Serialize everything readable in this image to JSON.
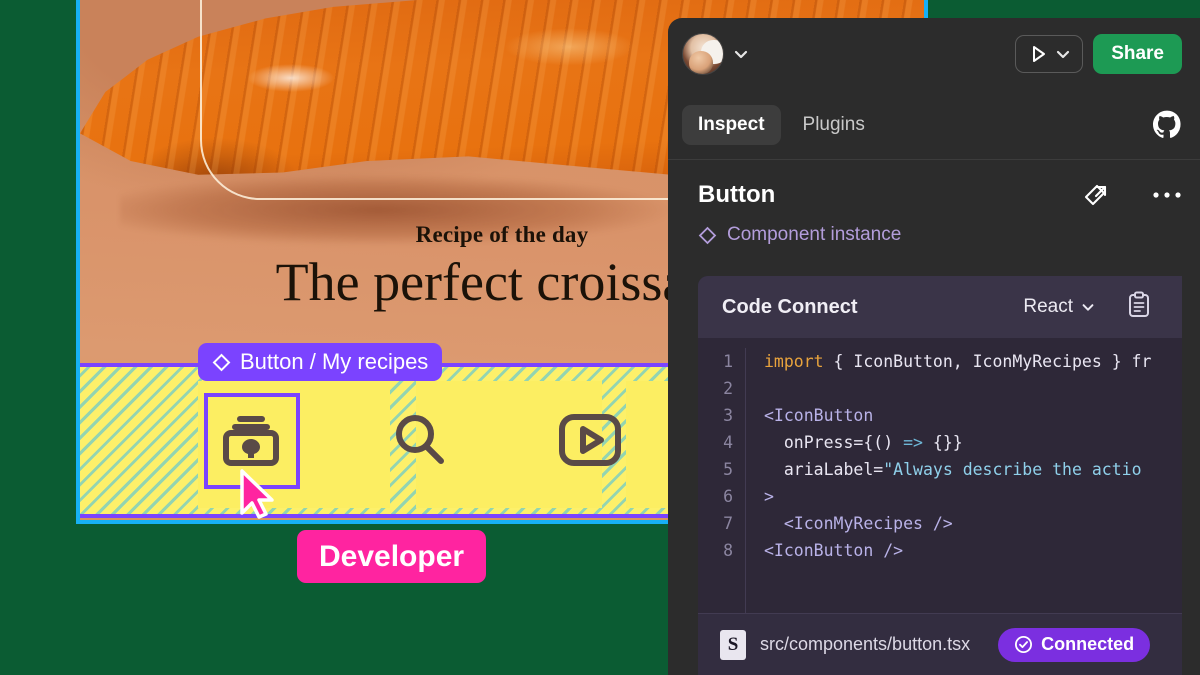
{
  "canvas": {
    "poster": {
      "kicker": "Recipe of the day",
      "headline": "The perfect croissant",
      "bg_color": "#d79465"
    },
    "component_chip": {
      "label": "Button / My recipes",
      "icon": "component-diamond-icon",
      "color": "#7b43ff"
    },
    "developer_badge": {
      "label": "Developer",
      "color": "#ff24a0"
    },
    "toolbar_icons": [
      {
        "name": "my-recipes-icon",
        "selected": true
      },
      {
        "name": "search-icon",
        "selected": false
      },
      {
        "name": "video-play-icon",
        "selected": false
      }
    ],
    "selection_color": "#17b0f5",
    "highlight_color": "#fdf06a"
  },
  "panel": {
    "topbar": {
      "avatar_label": "user-avatar",
      "avatar_caret": "chevron-down-icon",
      "run_label": "play-icon",
      "run_caret": "chevron-down-icon",
      "share_label": "Share",
      "share_color": "#1d9a54"
    },
    "tabs": [
      {
        "label": "Inspect",
        "active": true
      },
      {
        "label": "Plugins",
        "active": false
      }
    ],
    "github_icon": "github-icon",
    "node": {
      "title": "Button",
      "open_icon": "open-external-icon",
      "more_icon": "more-horizontal-icon",
      "instance_label": "Component instance",
      "instance_icon": "component-diamond-icon",
      "instance_color": "#b39ddb"
    },
    "code_connect": {
      "title": "Code Connect",
      "language": "React",
      "language_caret": "chevron-down-icon",
      "copy_icon": "copy-clipboard-icon",
      "lines": [
        {
          "n": "1",
          "tokens": [
            {
              "t": "import",
              "c": "kw"
            },
            {
              "t": " { IconButton, IconMyRecipes } fr",
              "c": "plain"
            }
          ]
        },
        {
          "n": "2",
          "tokens": []
        },
        {
          "n": "3",
          "tokens": [
            {
              "t": "<IconButton",
              "c": "tag"
            }
          ]
        },
        {
          "n": "4",
          "tokens": [
            {
              "t": "  onPress={() ",
              "c": "attr"
            },
            {
              "t": "=>",
              "c": "op"
            },
            {
              "t": " {}}",
              "c": "attr"
            }
          ]
        },
        {
          "n": "5",
          "tokens": [
            {
              "t": "  ariaLabel=",
              "c": "attr"
            },
            {
              "t": "\"Always describe the actio",
              "c": "str"
            }
          ]
        },
        {
          "n": "6",
          "tokens": [
            {
              "t": ">",
              "c": "tag"
            }
          ]
        },
        {
          "n": "7",
          "tokens": [
            {
              "t": "  <IconMyRecipes />",
              "c": "tag"
            }
          ]
        },
        {
          "n": "8",
          "tokens": [
            {
              "t": "<IconButton />",
              "c": "tag"
            }
          ]
        }
      ],
      "file_badge": "S",
      "file_path": "src/components/button.tsx",
      "status_label": "Connected",
      "status_icon": "check-circle-icon",
      "status_color": "#7b2fe0"
    }
  }
}
